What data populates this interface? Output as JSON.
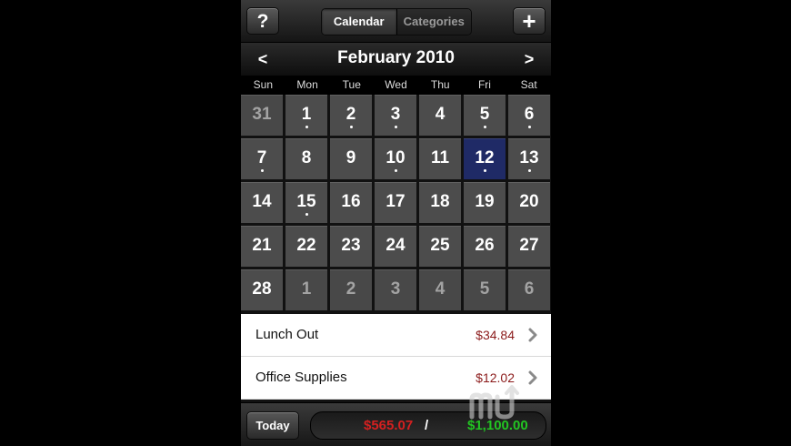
{
  "toolbar": {
    "help_label": "?",
    "add_label": "+",
    "tabs": [
      {
        "label": "Calendar",
        "selected": true
      },
      {
        "label": "Categories",
        "selected": false
      }
    ]
  },
  "calendar": {
    "month_title": "February 2010",
    "prev_label": "<",
    "next_label": ">",
    "weekdays": [
      "Sun",
      "Mon",
      "Tue",
      "Wed",
      "Thu",
      "Fri",
      "Sat"
    ],
    "selected_day": 12,
    "weeks": [
      [
        {
          "d": "31",
          "other": true,
          "dot": false
        },
        {
          "d": "1",
          "other": false,
          "dot": true
        },
        {
          "d": "2",
          "other": false,
          "dot": true
        },
        {
          "d": "3",
          "other": false,
          "dot": true
        },
        {
          "d": "4",
          "other": false,
          "dot": false
        },
        {
          "d": "5",
          "other": false,
          "dot": true
        },
        {
          "d": "6",
          "other": false,
          "dot": true
        }
      ],
      [
        {
          "d": "7",
          "other": false,
          "dot": true
        },
        {
          "d": "8",
          "other": false,
          "dot": false
        },
        {
          "d": "9",
          "other": false,
          "dot": false
        },
        {
          "d": "10",
          "other": false,
          "dot": true
        },
        {
          "d": "11",
          "other": false,
          "dot": false
        },
        {
          "d": "12",
          "other": false,
          "dot": true,
          "selected": true
        },
        {
          "d": "13",
          "other": false,
          "dot": true
        }
      ],
      [
        {
          "d": "14",
          "other": false,
          "dot": false
        },
        {
          "d": "15",
          "other": false,
          "dot": true
        },
        {
          "d": "16",
          "other": false,
          "dot": false
        },
        {
          "d": "17",
          "other": false,
          "dot": false
        },
        {
          "d": "18",
          "other": false,
          "dot": false
        },
        {
          "d": "19",
          "other": false,
          "dot": false
        },
        {
          "d": "20",
          "other": false,
          "dot": false
        }
      ],
      [
        {
          "d": "21",
          "other": false,
          "dot": false
        },
        {
          "d": "22",
          "other": false,
          "dot": false
        },
        {
          "d": "23",
          "other": false,
          "dot": false
        },
        {
          "d": "24",
          "other": false,
          "dot": false
        },
        {
          "d": "25",
          "other": false,
          "dot": false
        },
        {
          "d": "26",
          "other": false,
          "dot": false
        },
        {
          "d": "27",
          "other": false,
          "dot": false
        }
      ],
      [
        {
          "d": "28",
          "other": false,
          "dot": false
        },
        {
          "d": "1",
          "other": true,
          "dot": false
        },
        {
          "d": "2",
          "other": true,
          "dot": false
        },
        {
          "d": "3",
          "other": true,
          "dot": false
        },
        {
          "d": "4",
          "other": true,
          "dot": false
        },
        {
          "d": "5",
          "other": true,
          "dot": false
        },
        {
          "d": "6",
          "other": true,
          "dot": false
        }
      ]
    ]
  },
  "expenses": [
    {
      "name": "Lunch Out",
      "amount": "$34.84"
    },
    {
      "name": "Office Supplies",
      "amount": "$12.02"
    }
  ],
  "bottom": {
    "today_label": "Today",
    "spent": "$565.07",
    "separator": "/",
    "budget": "$1,100.00"
  },
  "colors": {
    "selected_day": "#1f2a66",
    "expense_amount": "#8b1a1a",
    "spent_total": "#d42020",
    "budget_total": "#22c422"
  },
  "icons": {
    "row_chevron": "chevron-right-icon",
    "watermark": "macupdate-logo"
  }
}
